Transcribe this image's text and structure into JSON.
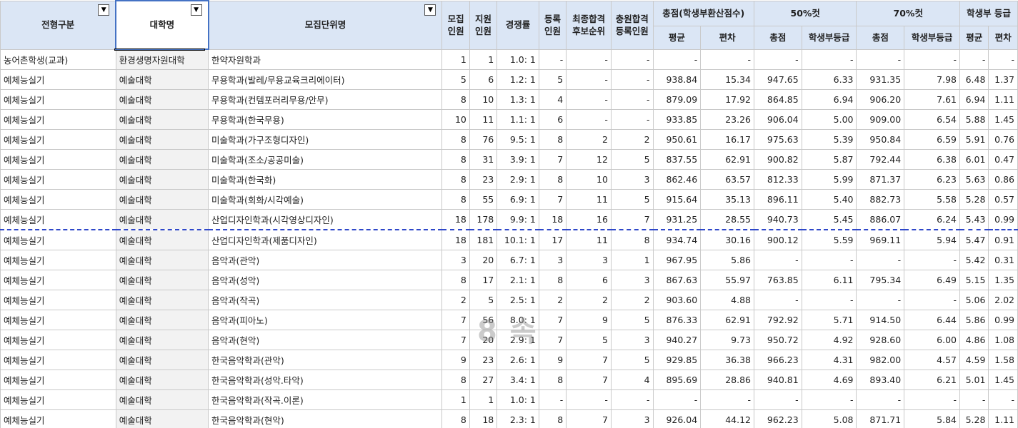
{
  "headers": {
    "type": "전형구분",
    "univ": "대학명",
    "unit": "모집단위명",
    "recruit": [
      "모집",
      "인원"
    ],
    "apply": [
      "지원",
      "인원"
    ],
    "ratio": "경쟁률",
    "enroll": [
      "등록",
      "인원"
    ],
    "final": [
      "최종합격",
      "후보순위"
    ],
    "extra": [
      "충원합격",
      "등록인원"
    ],
    "total_group": "총점(학생부환산점수)",
    "p50_group": "50%컷",
    "p70_group": "70%컷",
    "grade_group": "학생부 등급",
    "avg": "평균",
    "dev": "편차",
    "total": "총점",
    "grade": "학생부등급",
    "filter_icon": "▼"
  },
  "rows": [
    [
      "농어촌학생(교과)",
      "환경생명자원대학",
      "한약자원학과",
      "1",
      "1",
      "1.0: 1",
      "-",
      "-",
      "-",
      "-",
      "-",
      "-",
      "-",
      "-",
      "-",
      "-",
      "-"
    ],
    [
      "예체능실기",
      "예술대학",
      "무용학과(발레/무용교육크리에이터)",
      "5",
      "6",
      "1.2: 1",
      "5",
      "-",
      "-",
      "938.84",
      "15.34",
      "947.65",
      "6.33",
      "931.35",
      "7.98",
      "6.48",
      "1.37"
    ],
    [
      "예체능실기",
      "예술대학",
      "무용학과(컨템포러리무용/안무)",
      "8",
      "10",
      "1.3: 1",
      "4",
      "-",
      "-",
      "879.09",
      "17.92",
      "864.85",
      "6.94",
      "906.20",
      "7.61",
      "6.94",
      "1.11"
    ],
    [
      "예체능실기",
      "예술대학",
      "무용학과(한국무용)",
      "10",
      "11",
      "1.1: 1",
      "6",
      "-",
      "-",
      "933.85",
      "23.26",
      "906.04",
      "5.00",
      "909.00",
      "6.54",
      "5.88",
      "1.45"
    ],
    [
      "예체능실기",
      "예술대학",
      "미술학과(가구조형디자인)",
      "8",
      "76",
      "9.5: 1",
      "8",
      "2",
      "2",
      "950.61",
      "16.17",
      "975.63",
      "5.39",
      "950.84",
      "6.59",
      "5.91",
      "0.76"
    ],
    [
      "예체능실기",
      "예술대학",
      "미술학과(조소/공공미술)",
      "8",
      "31",
      "3.9: 1",
      "7",
      "12",
      "5",
      "837.55",
      "62.91",
      "900.82",
      "5.87",
      "792.44",
      "6.38",
      "6.01",
      "0.47"
    ],
    [
      "예체능실기",
      "예술대학",
      "미술학과(한국화)",
      "8",
      "23",
      "2.9: 1",
      "8",
      "10",
      "3",
      "862.46",
      "63.57",
      "812.33",
      "5.99",
      "871.37",
      "6.23",
      "5.63",
      "0.86"
    ],
    [
      "예체능실기",
      "예술대학",
      "미술학과(회화/시각예술)",
      "8",
      "55",
      "6.9: 1",
      "7",
      "11",
      "5",
      "915.64",
      "35.13",
      "896.11",
      "5.40",
      "882.73",
      "5.58",
      "5.28",
      "0.57"
    ],
    [
      "예체능실기",
      "예술대학",
      "산업디자인학과(시각영상디자인)",
      "18",
      "178",
      "9.9: 1",
      "18",
      "16",
      "7",
      "931.25",
      "28.55",
      "940.73",
      "5.45",
      "886.07",
      "6.24",
      "5.43",
      "0.99"
    ],
    [
      "예체능실기",
      "예술대학",
      "산업디자인학과(제품디자인)",
      "18",
      "181",
      "10.1: 1",
      "17",
      "11",
      "8",
      "934.74",
      "30.16",
      "900.12",
      "5.59",
      "969.11",
      "5.94",
      "5.47",
      "0.91"
    ],
    [
      "예체능실기",
      "예술대학",
      "음악과(관악)",
      "3",
      "20",
      "6.7: 1",
      "3",
      "3",
      "1",
      "967.95",
      "5.86",
      "-",
      "-",
      "-",
      "-",
      "5.42",
      "0.31"
    ],
    [
      "예체능실기",
      "예술대학",
      "음악과(성악)",
      "8",
      "17",
      "2.1: 1",
      "8",
      "6",
      "3",
      "867.63",
      "55.97",
      "763.85",
      "6.11",
      "795.34",
      "6.49",
      "5.15",
      "1.35"
    ],
    [
      "예체능실기",
      "예술대학",
      "음악과(작곡)",
      "2",
      "5",
      "2.5: 1",
      "2",
      "2",
      "2",
      "903.60",
      "4.88",
      "-",
      "-",
      "-",
      "-",
      "5.06",
      "2.02"
    ],
    [
      "예체능실기",
      "예술대학",
      "음악과(피아노)",
      "7",
      "56",
      "8.0: 1",
      "7",
      "9",
      "5",
      "876.33",
      "62.91",
      "792.92",
      "5.71",
      "914.50",
      "6.44",
      "5.86",
      "0.99"
    ],
    [
      "예체능실기",
      "예술대학",
      "음악과(현악)",
      "7",
      "20",
      "2.9: 1",
      "7",
      "5",
      "3",
      "940.27",
      "9.73",
      "950.72",
      "4.92",
      "928.60",
      "6.00",
      "4.86",
      "1.08"
    ],
    [
      "예체능실기",
      "예술대학",
      "한국음악학과(관악)",
      "9",
      "23",
      "2.6: 1",
      "9",
      "7",
      "5",
      "929.85",
      "36.38",
      "966.23",
      "4.31",
      "982.00",
      "4.57",
      "4.59",
      "1.58"
    ],
    [
      "예체능실기",
      "예술대학",
      "한국음악학과(성악.타악)",
      "8",
      "27",
      "3.4: 1",
      "8",
      "7",
      "4",
      "895.69",
      "28.86",
      "940.81",
      "4.69",
      "893.40",
      "6.21",
      "5.01",
      "1.45"
    ],
    [
      "예체능실기",
      "예술대학",
      "한국음악학과(작곡.이론)",
      "1",
      "1",
      "1.0: 1",
      "-",
      "-",
      "-",
      "-",
      "-",
      "-",
      "-",
      "-",
      "-",
      "-",
      "-"
    ],
    [
      "예체능실기",
      "예술대학",
      "한국음악학과(현악)",
      "8",
      "18",
      "2.3: 1",
      "8",
      "7",
      "3",
      "926.04",
      "44.12",
      "962.23",
      "5.08",
      "871.71",
      "5.84",
      "5.28",
      "1.11"
    ]
  ],
  "watermark": "8 속"
}
